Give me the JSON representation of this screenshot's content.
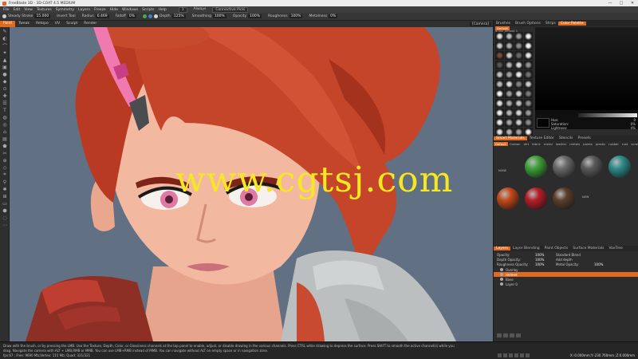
{
  "window": {
    "title": "FreeBlade 3D - 3D-COAT 4.5 MEDIUM",
    "controls": [
      "—",
      "□",
      "✕"
    ]
  },
  "menu": {
    "items": [
      "File",
      "Edit",
      "View",
      "Textures",
      "Symmetry",
      "Layers",
      "Freeze",
      "Hide",
      "Windows",
      "Scripts",
      "Help"
    ],
    "right": [
      "Always",
      "Connective Picki"
    ],
    "stepper": "1"
  },
  "options": {
    "items": [
      {
        "label": "Steady Stroke",
        "value": "15.000"
      },
      {
        "label": "Invert Tool",
        "value": ""
      },
      {
        "label": "Radius",
        "value": "6.469"
      },
      {
        "label": "Falloff",
        "value": "0%"
      },
      {
        "label": "Depth",
        "value": "125%"
      },
      {
        "label": "Smoothing",
        "value": "100%"
      },
      {
        "label": "Opacity",
        "value": "100%"
      },
      {
        "label": "Roughness",
        "value": "100%"
      },
      {
        "label": "Metalness",
        "value": "0%"
      }
    ]
  },
  "rooms": {
    "tabs": [
      "Paint",
      "Tweak",
      "Retopo",
      "UV",
      "Sculpt",
      "Render"
    ],
    "active": "Paint",
    "camera": "[Camera]"
  },
  "tools": [
    "✎",
    "◐",
    "⌒",
    "✦",
    "▲",
    "▣",
    "●",
    "◆",
    "⊙",
    "✚",
    "☰",
    "T",
    "◍",
    "◎",
    "⌂",
    "▤",
    "⬟",
    "✂",
    "⊕",
    "◇",
    "⌗",
    "⚲",
    "✱",
    "⊞",
    "▭",
    "⬢",
    "◌",
    "⋯"
  ],
  "viewport": {
    "watermark": "www.cgtsj.com"
  },
  "right_panel": {
    "top_tabs": [
      "Brushes",
      "Brush Options",
      "Strips",
      "Color Palette"
    ],
    "active_top": "Color Palette",
    "brush_subtab": "Default",
    "brush_header": "brush_default 1",
    "color": {
      "hue": {
        "label": "Hue:",
        "value": "0"
      },
      "saturation": {
        "label": "Saturation:",
        "value": "0%"
      },
      "lightness": {
        "label": "Lightness:",
        "value": "4%"
      }
    },
    "material_tabs": [
      "Smart Materials",
      "Texture Editor",
      "Stencils",
      "Presets"
    ],
    "active_material_tab": "Smart Materials",
    "material_filters": [
      "Default",
      "Carbon",
      "dirt",
      "fabric",
      "metal",
      "leather",
      "metals",
      "paints",
      "plastic",
      "rubber",
      "rust",
      "scratches",
      "wood"
    ],
    "active_filter": "Default",
    "materials": [
      {
        "name": "",
        "color": "#d9d9d9",
        "label": "NONE"
      },
      {
        "name": "",
        "color": "#3fa23a"
      },
      {
        "name": "",
        "color": "#6a6a6a"
      },
      {
        "name": "",
        "color": "#5b5b5b"
      },
      {
        "name": "",
        "color": "#2f8d8a"
      },
      {
        "name": "",
        "color": "#c44a1b"
      },
      {
        "name": "",
        "color": "#b61f26"
      },
      {
        "name": "",
        "color": "#5c3f2a"
      },
      {
        "name": "",
        "color": "#2c2c2c",
        "label": "NEW"
      }
    ],
    "layer_tabs": [
      "Layers",
      "Layer Blending",
      "Paint Objects",
      "Surface Materials",
      "VoxTree"
    ],
    "active_layer_tab": "Layers",
    "layer_params": [
      {
        "k": "Opacity:",
        "v": "100%",
        "k2": "Standard Blend"
      },
      {
        "k": "Depth Opacity:",
        "v": "100%",
        "k2": "Add depth"
      },
      {
        "k": "Roughness Opacity:",
        "v": "100%",
        "k2": "Metal Opacity:",
        "v2": "100%"
      }
    ],
    "layers": [
      {
        "name": "Overlay",
        "selected": false
      },
      {
        "name": "Helmet",
        "selected": true
      },
      {
        "name": "Base",
        "selected": false
      },
      {
        "name": "Layer 0",
        "selected": false
      }
    ]
  },
  "status": {
    "line1": "Draw with the brush, or by pressing the LMB. Use the Texture, Depth, Color, or Glossiness channels at the top panel to enable, adjust, or disable drawing in the various channels. Press CTRL while drawing to depress the surface. Press SHIFT to smooth the active channel(s) while you",
    "line2": "drag. Navigate the camera with ALT + LMB,RMB or MMB. You can use LMB+RMB instead of MMB. You can navigate without ALT on empty space or in navigation zone.",
    "fps": "fps:67 ; Free: 9690 Mb;Vertex: 115 Mb; Quad: 321/321",
    "coords": "X:-0.000mm;Y:-230.760mm ;Z:0.000mm"
  },
  "colors": {
    "accent": "#e06a1e",
    "viewport_bg": "#606e80",
    "watermark": "#f5e722"
  }
}
